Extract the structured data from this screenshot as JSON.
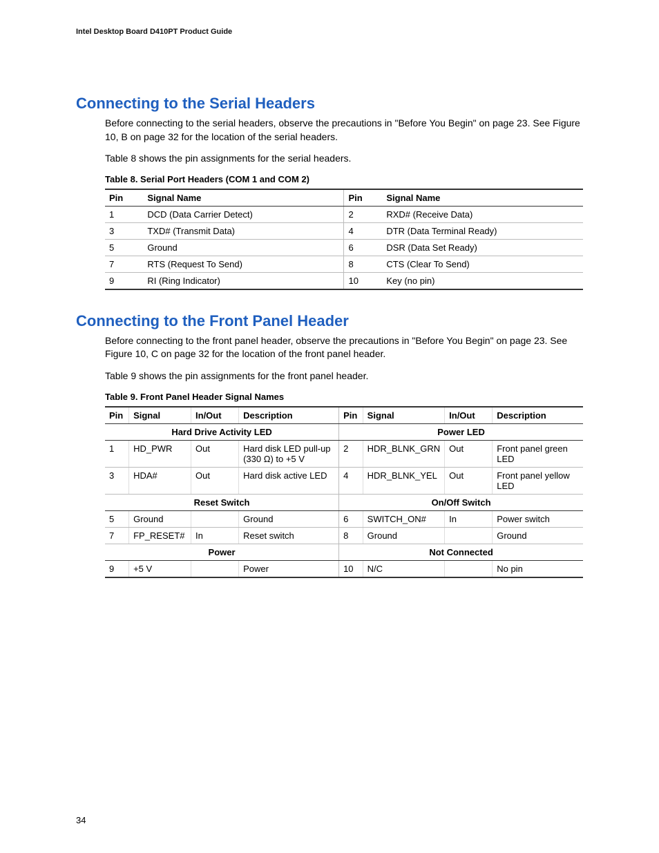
{
  "header": "Intel Desktop Board D410PT Product Guide",
  "page_number": "34",
  "section1": {
    "title": "Connecting to the Serial Headers",
    "para1": "Before connecting to the serial headers, observe the precautions in \"Before You Begin\" on page 23.  See Figure 10, B on page 32 for the location of the serial headers.",
    "para2": "Table 8 shows the pin assignments for the serial headers.",
    "table_caption": "Table 8.   Serial Port Headers (COM 1 and COM 2)",
    "table_headers": [
      "Pin",
      "Signal Name",
      "Pin",
      "Signal Name"
    ],
    "rows": [
      [
        "1",
        "DCD (Data Carrier Detect)",
        "2",
        "RXD# (Receive Data)"
      ],
      [
        "3",
        "TXD# (Transmit Data)",
        "4",
        "DTR (Data Terminal Ready)"
      ],
      [
        "5",
        "Ground",
        "6",
        "DSR (Data Set Ready)"
      ],
      [
        "7",
        "RTS (Request To Send)",
        "8",
        "CTS (Clear To Send)"
      ],
      [
        "9",
        "RI (Ring Indicator)",
        "10",
        "Key (no pin)"
      ]
    ]
  },
  "section2": {
    "title": "Connecting to the Front Panel Header",
    "para1": "Before connecting to the front panel header, observe the precautions in \"Before You Begin\" on page 23.  See Figure 10, C on page 32 for the location of the front panel header.",
    "para2": "Table 9 shows the pin assignments for the front panel header.",
    "table_caption": "Table 9.   Front Panel Header Signal Names",
    "table_headers": [
      "Pin",
      "Signal",
      "In/Out",
      "Description",
      "Pin",
      "Signal",
      "In/Out",
      "Description"
    ],
    "group1": {
      "left": "Hard Drive Activity LED",
      "right": "Power LED"
    },
    "rows1": [
      [
        "1",
        "HD_PWR",
        "Out",
        "Hard disk LED pull-up (330 Ω) to +5 V",
        "2",
        "HDR_BLNK_GRN",
        "Out",
        "Front panel green LED"
      ],
      [
        "3",
        "HDA#",
        "Out",
        "Hard disk active LED",
        "4",
        "HDR_BLNK_YEL",
        "Out",
        "Front panel yellow LED"
      ]
    ],
    "group2": {
      "left": "Reset Switch",
      "right": "On/Off Switch"
    },
    "rows2": [
      [
        "5",
        "Ground",
        "",
        "Ground",
        "6",
        "SWITCH_ON#",
        "In",
        "Power switch"
      ],
      [
        "7",
        "FP_RESET#",
        "In",
        "Reset switch",
        "8",
        "Ground",
        "",
        "Ground"
      ]
    ],
    "group3": {
      "left": "Power",
      "right": "Not Connected"
    },
    "rows3": [
      [
        "9",
        "+5 V",
        "",
        "Power",
        "10",
        "N/C",
        "",
        "No pin"
      ]
    ]
  }
}
